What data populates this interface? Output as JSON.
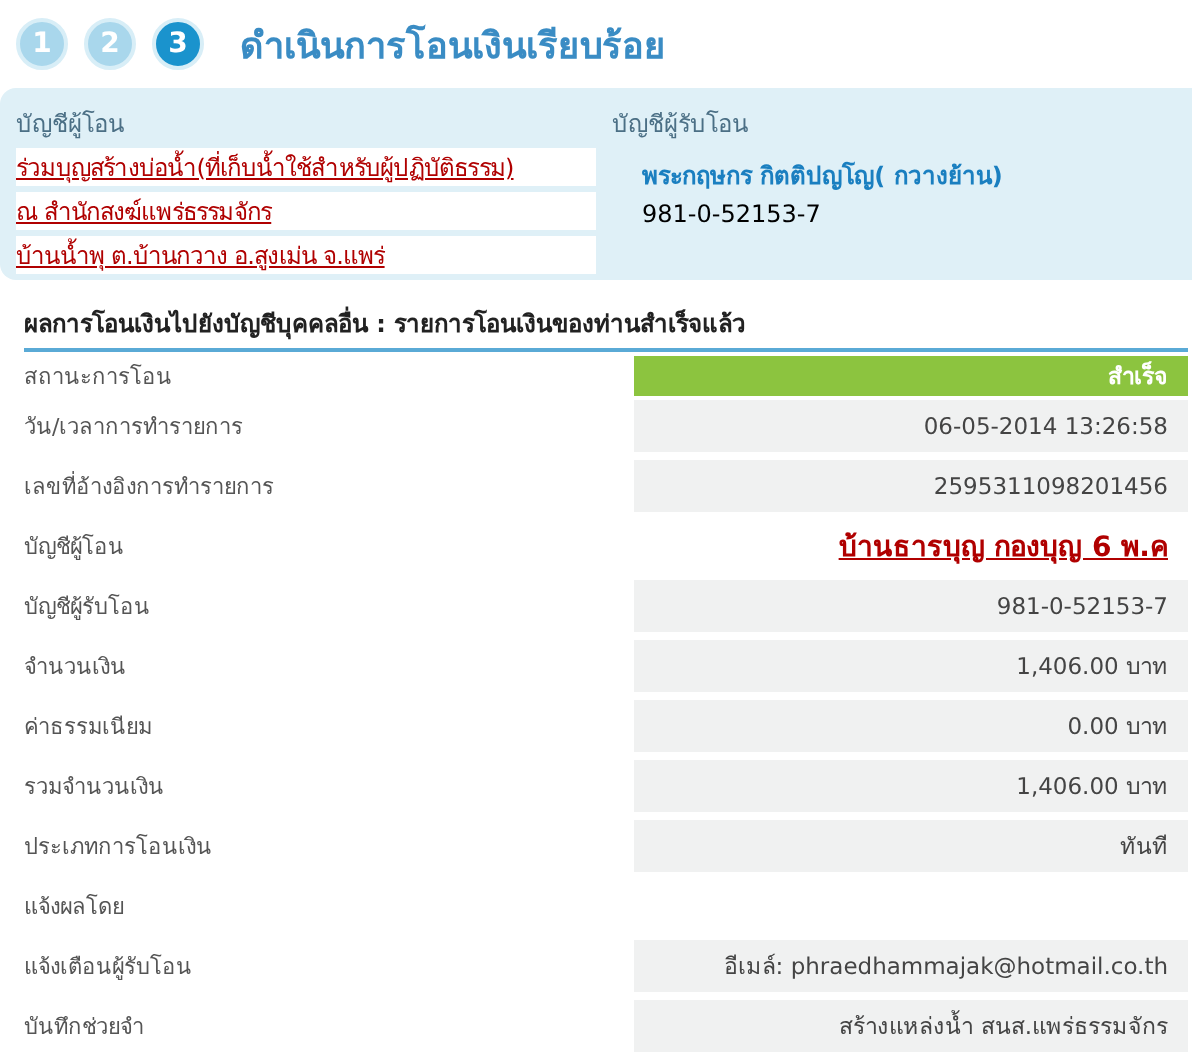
{
  "steps": [
    {
      "label": "1",
      "selected": false
    },
    {
      "label": "2",
      "selected": false
    },
    {
      "label": "3",
      "selected": true
    }
  ],
  "title": "ดำเนินการโอนเงินเรียบร้อย",
  "from_account": {
    "heading": "บัญชีผู้โอน",
    "lines": [
      "ร่วมบุญสร้างบ่อน้ำ(ที่เก็บน้ำใช้สำหรับผู้ปฏิบัติธรรม)",
      "ณ สำนักสงฆ์แพร่ธรรมจักร",
      "บ้านน้ำพุ ต.บ้านกวาง อ.สูงเม่น จ.แพร่"
    ]
  },
  "to_account": {
    "heading": "บัญชีผู้รับโอน",
    "name": "พระกฤษกร กิตติปญโญ( กวางย้าน)",
    "number": "981-0-52153-7"
  },
  "result": {
    "title": "ผลการโอนเงินไปยังบัญชีบุคคลอื่น : รายการโอนเงินของท่านสำเร็จแล้ว",
    "rows": [
      {
        "label": "สถานะการโอน",
        "value": "สำเร็จ",
        "kind": "status"
      },
      {
        "label": "วัน/เวลาการทำรายการ",
        "value": "06-05-2014 13:26:58",
        "kind": "plain"
      },
      {
        "label": "เลขที่อ้างอิงการทำรายการ",
        "value": "2595311098201456",
        "kind": "plain"
      },
      {
        "label": "บัญชีผู้โอน",
        "value": "บ้านธารบุญ กองบุญ 6 พ.ค",
        "kind": "note"
      },
      {
        "label": "บัญชีผู้รับโอน",
        "value": "981-0-52153-7",
        "kind": "plain"
      },
      {
        "label": "จำนวนเงิน",
        "value": "1,406.00 บาท",
        "kind": "plain"
      },
      {
        "label": "ค่าธรรมเนียม",
        "value": "0.00 บาท",
        "kind": "plain"
      },
      {
        "label": "รวมจำนวนเงิน",
        "value": "1,406.00 บาท",
        "kind": "plain"
      },
      {
        "label": "ประเภทการโอนเงิน",
        "value": "ทันที",
        "kind": "plain"
      },
      {
        "label": "แจ้งผลโดย",
        "kind": "empty"
      },
      {
        "label": "แจ้งเตือนผู้รับโอน",
        "value": "อีเมล์: phraedhammajak@hotmail.co.th",
        "kind": "plain"
      },
      {
        "label": "บันทึกช่วยจำ",
        "value": "สร้างแหล่งน้ำ สนส.แพร่ธรรมจักร",
        "kind": "plain"
      }
    ]
  }
}
